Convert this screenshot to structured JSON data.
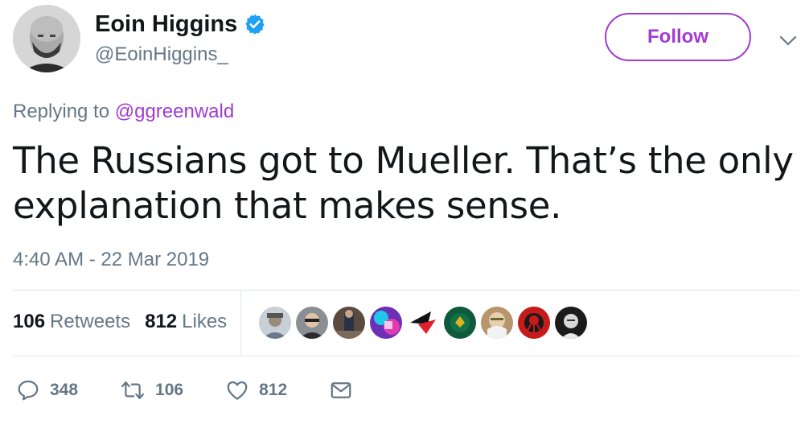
{
  "author": {
    "display_name": "Eoin Higgins",
    "handle": "@EoinHiggins_",
    "verified": true
  },
  "follow_label": "Follow",
  "reply_context": {
    "prefix": "Replying to",
    "mention": "@ggreenwald"
  },
  "tweet": {
    "text": "The Russians got to Mueller. That’s the only explanation that makes sense.",
    "timestamp": "4:40 AM - 22 Mar 2019"
  },
  "stats": {
    "retweets_count": "106",
    "retweets_label": "Retweets",
    "likes_count": "812",
    "likes_label": "Likes"
  },
  "likers": [
    {
      "icon": "liker-avatar-1"
    },
    {
      "icon": "liker-avatar-2"
    },
    {
      "icon": "liker-avatar-3"
    },
    {
      "icon": "liker-avatar-4"
    },
    {
      "icon": "liker-avatar-5"
    },
    {
      "icon": "liker-avatar-6"
    },
    {
      "icon": "liker-avatar-7"
    },
    {
      "icon": "liker-avatar-8"
    },
    {
      "icon": "liker-avatar-9"
    }
  ],
  "actions": {
    "reply_count": "348",
    "retweet_count": "106",
    "like_count": "812"
  },
  "colors": {
    "accent": "#a23bd1",
    "verified": "#1da1f2",
    "muted": "#657786",
    "text": "#14171a",
    "divider": "#e1e8ed"
  },
  "icons": {
    "verified": "verified-badge-icon",
    "more": "chevron-down-icon",
    "reply": "reply-icon",
    "retweet": "retweet-icon",
    "like": "heart-icon",
    "dm": "envelope-icon"
  }
}
